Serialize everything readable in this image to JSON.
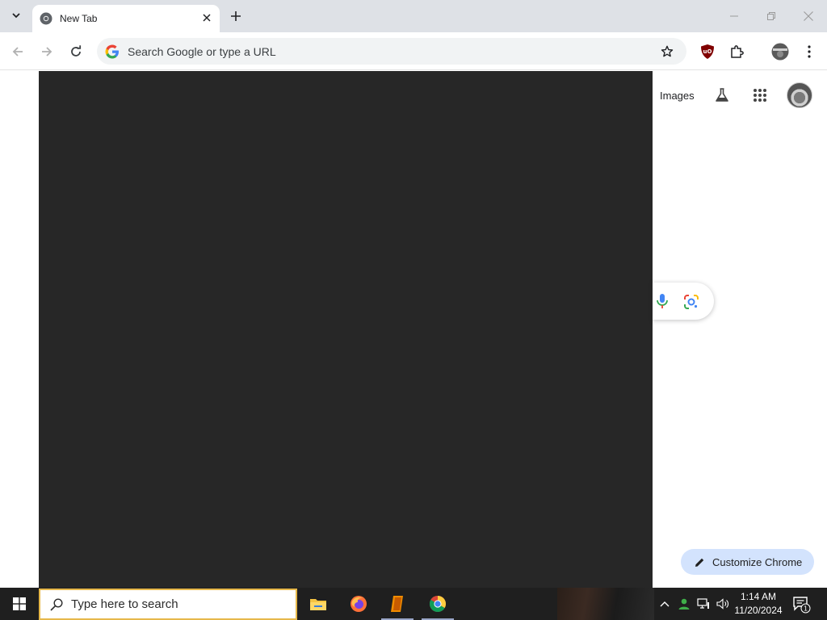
{
  "browser": {
    "tab": {
      "title": "New Tab"
    },
    "omnibox": {
      "placeholder": "Search Google or type a URL"
    }
  },
  "page": {
    "header": {
      "images_link": "Images"
    },
    "customize_button": "Customize Chrome"
  },
  "taskbar": {
    "search_placeholder": "Type here to search",
    "pinned_apps": [
      "File Explorer",
      "Firefox",
      "App",
      "Google Chrome"
    ],
    "clock": {
      "time": "1:14 AM",
      "date": "11/20/2024"
    },
    "notification_count": "1"
  },
  "colors": {
    "tabstrip_bg": "#dee1e6",
    "overlay": "#272727",
    "customize_bg": "#d3e3fd",
    "taskbar_bg": "#1f1f1f"
  }
}
